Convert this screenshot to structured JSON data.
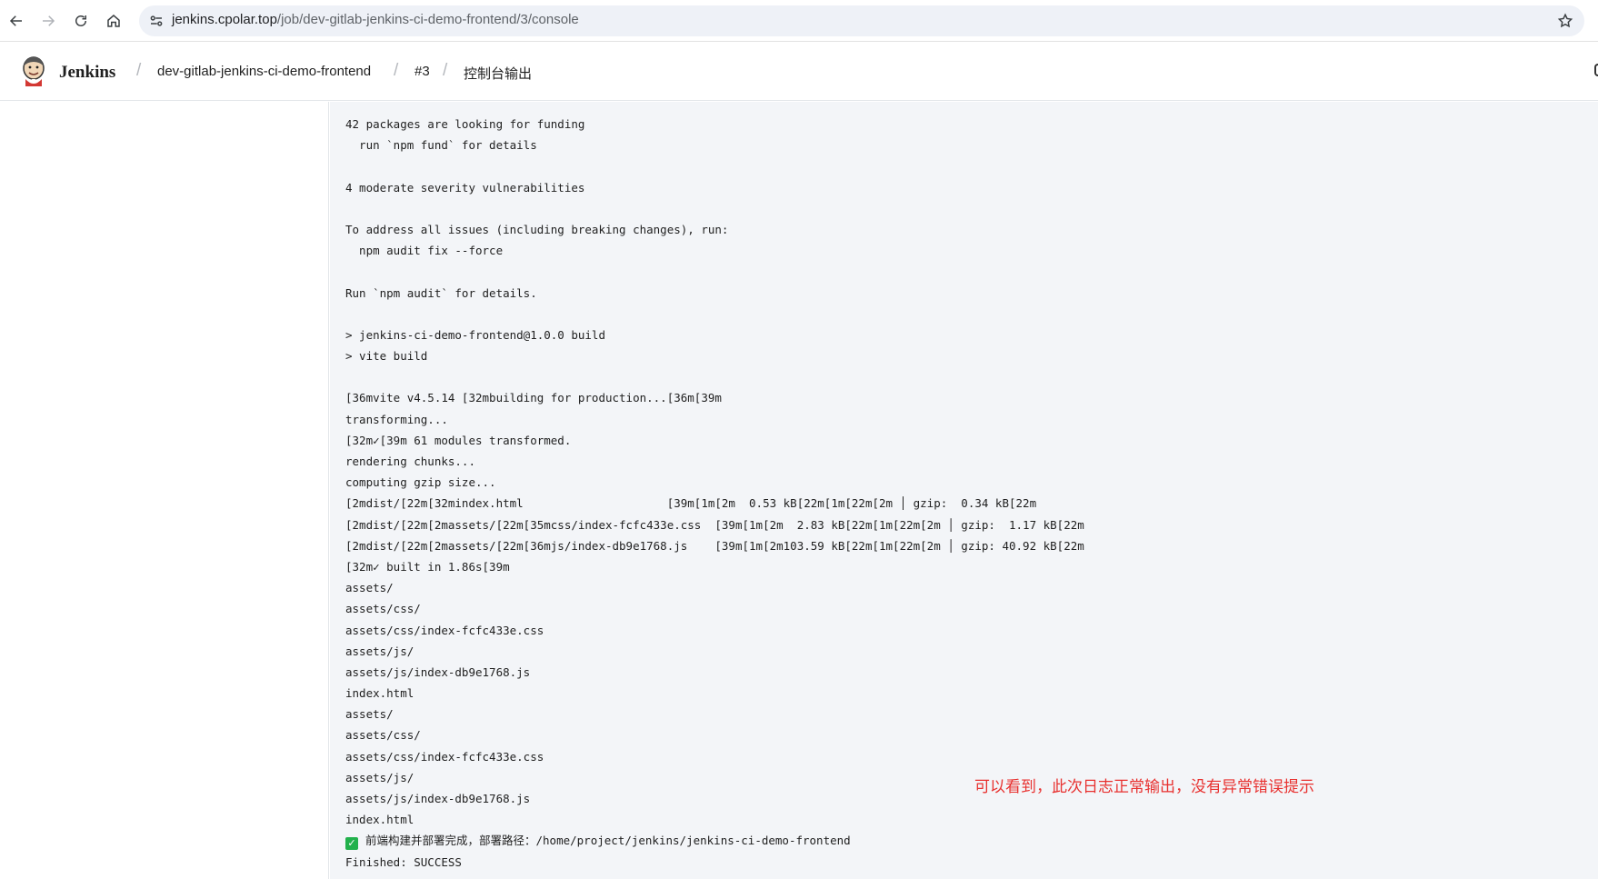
{
  "browser": {
    "url_host": "jenkins.cpolar.top",
    "url_path": "/job/dev-gitlab-jenkins-ci-demo-frontend/3/console"
  },
  "header": {
    "brand": "Jenkins",
    "breadcrumbs": [
      "dev-gitlab-jenkins-ci-demo-frontend",
      "#3",
      "控制台输出"
    ]
  },
  "console": {
    "lines": [
      "42 packages are looking for funding",
      "  run `npm fund` for details",
      "",
      "4 moderate severity vulnerabilities",
      "",
      "To address all issues (including breaking changes), run:",
      "  npm audit fix --force",
      "",
      "Run `npm audit` for details.",
      "",
      "> jenkins-ci-demo-frontend@1.0.0 build",
      "> vite build",
      "",
      "[36mvite v4.5.14 [32mbuilding for production...[36m[39m",
      "transforming...",
      "[32m✓[39m 61 modules transformed.",
      "rendering chunks...",
      "computing gzip size...",
      "[2mdist/[22m[32mindex.html                     [39m[1m[2m  0.53 kB[22m[1m[22m[2m │ gzip:  0.34 kB[22m",
      "[2mdist/[22m[2massets/[22m[35mcss/index-fcfc433e.css  [39m[1m[2m  2.83 kB[22m[1m[22m[2m │ gzip:  1.17 kB[22m",
      "[2mdist/[22m[2massets/[22m[36mjs/index-db9e1768.js    [39m[1m[2m103.59 kB[22m[1m[22m[2m │ gzip: 40.92 kB[22m",
      "[32m✓ built in 1.86s[39m",
      "assets/",
      "assets/css/",
      "assets/css/index-fcfc433e.css",
      "assets/js/",
      "assets/js/index-db9e1768.js",
      "index.html",
      "assets/",
      "assets/css/",
      "assets/css/index-fcfc433e.css",
      "assets/js/",
      "assets/js/index-db9e1768.js",
      "index.html"
    ],
    "deploy_message": "前端构建并部署完成，部署路径：/home/project/jenkins/jenkins-ci-demo-frontend",
    "finished": "Finished: SUCCESS"
  },
  "annotation": "可以看到，此次日志正常输出，没有异常错误提示",
  "colors": {
    "console_bg": "#f3f5f8",
    "annotation": "#e8312f",
    "success_check": "#22b14c"
  },
  "icons": [
    "back-arrow-icon",
    "forward-arrow-icon",
    "reload-icon",
    "home-icon",
    "site-info-icon",
    "bookmark-star-icon",
    "jenkins-logo-icon",
    "check-mark-icon"
  ]
}
